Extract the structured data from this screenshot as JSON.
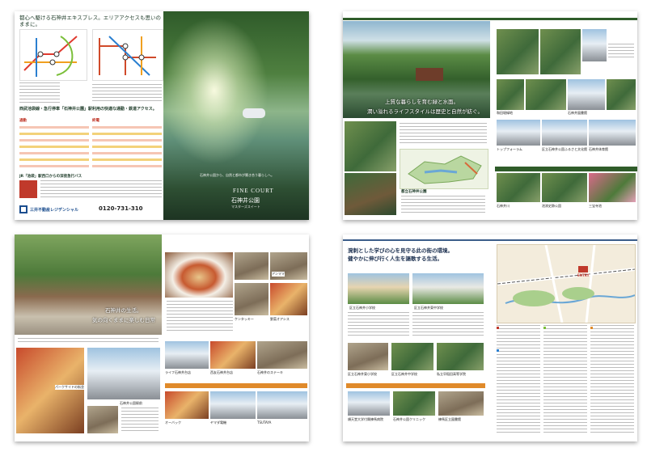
{
  "spread1": {
    "headline": "都心へ駆ける石神井エキスプレス。エリアアクセスも思いのままに。",
    "section_title": "西武池袋線・急行停車「石神井公園」駅利用の快適な通勤・鉄道アクセス。",
    "table_label_left": "通勤",
    "table_label_right": "終電",
    "bus_title": "JR「池袋」駅西口からの深夜急行バス",
    "brand_name": "三井不動産レジデンシャル",
    "phone": "0120-731-310",
    "logo_word": "FINE COURT",
    "property_name": "石神井公園",
    "property_sub": "マスターズスイート",
    "cover_copy": "石神井公園から、自然と都市が響き合う暮らしへ。"
  },
  "spread2": {
    "copy_line1": "上質な暮らしを育む緑と水面。",
    "copy_line2": "潤い溢れるライフスタイルは歴史と自然が紡ぐ。",
    "park_label": "都立石神井公園",
    "captions": [
      "和田堀緑地",
      "石神井図書館",
      "トップフォーラム",
      "区立石神井公園ふるさと文化館",
      "石神井体育館",
      "石神井川",
      "池渕史跡公園",
      "三宝寺池"
    ],
    "strip_title": "四季をまとう石神井の公園・緑地"
  },
  "spread3": {
    "copy_line1": "石神井の生活。",
    "copy_line2": "気の向くままに楽しむ日常",
    "captions": [
      "パークサイドの街並",
      "石神井公園駅前",
      "ライフ石神井台店",
      "アンママ",
      "ケンタッキー",
      "野菜オアシス",
      "西友石神井台店",
      "石神井のステーキ",
      "オーバック",
      "ヤマダ電機",
      "TSUTAYA"
    ],
    "strip_title": "周辺・生活便利なショッピングスポット"
  },
  "spread4": {
    "headline_line1": "溌剌とした学びの心を見守る此の街の環境。",
    "headline_line2": "健やかに伸び行く人生を謳歌する生活。",
    "captions": [
      "区立石神井小学校",
      "区立石神井東中学校",
      "区立石神井東小学校",
      "区立石神井中学校",
      "私立早稲田高等学院",
      "順天堂大学付属練馬病院",
      "石神井公園クリニック",
      "練馬区立図書館"
    ],
    "strip_title": "生活を支える教育・医療施設",
    "map_label": "ENTRY"
  }
}
